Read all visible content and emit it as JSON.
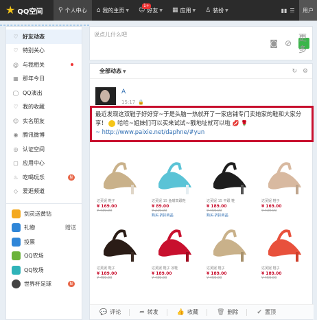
{
  "topbar": {
    "logo_text": "QQ空间",
    "nav": [
      {
        "label": "个人中心",
        "icon": "person-icon"
      },
      {
        "label": "我的主页",
        "icon": "home-icon",
        "caret": "▼"
      },
      {
        "label": "好友",
        "icon": "friends-icon",
        "caret": "▼",
        "badge": "1+"
      },
      {
        "label": "应用",
        "icon": "apps-icon",
        "caret": "▼"
      },
      {
        "label": "装扮",
        "icon": "shirt-icon",
        "caret": "▼"
      }
    ],
    "user_center": "用户"
  },
  "sidebar": {
    "items": [
      {
        "label": "好友动态",
        "icon": "♡"
      },
      {
        "label": "特别关心",
        "icon": "♡"
      },
      {
        "label": "与我相关",
        "icon": "@"
      },
      {
        "label": "那年今日",
        "icon": "▦"
      },
      {
        "label": "QQ演出",
        "icon": "◯"
      },
      {
        "label": "我的收藏",
        "icon": "♡"
      },
      {
        "label": "实名朋友",
        "icon": "☺"
      },
      {
        "label": "腾讯微博",
        "icon": "◉"
      },
      {
        "label": "认证空间",
        "icon": "◎"
      },
      {
        "label": "应用中心",
        "icon": "▢"
      },
      {
        "label": "吃喝玩乐",
        "icon": "♨",
        "badge": "N"
      },
      {
        "label": "爱逛频道",
        "icon": "◇"
      }
    ],
    "apps": [
      {
        "label": "剑灵送黄钻",
        "color": "#f4a91e"
      },
      {
        "label": "礼物",
        "color": "#2f86d8",
        "extra": "赠送"
      },
      {
        "label": "投票",
        "color": "#2f86d8"
      },
      {
        "label": "QQ农场",
        "color": "#6bb33a"
      },
      {
        "label": "QQ牧场",
        "color": "#2fb3b8"
      },
      {
        "label": "世界杯足球",
        "color": "#444",
        "badge": "N"
      }
    ]
  },
  "composer": {
    "placeholder": "说点儿什么吧",
    "tools": [
      "camera-icon",
      "attachment-icon",
      "more-icon"
    ],
    "tool_chars": [
      "◙",
      "⊘"
    ],
    "more_label": "更多"
  },
  "feed": {
    "filter_label": "全部动态",
    "filter_caret": "▼",
    "refresh_icon": "↻",
    "settings_icon": "⚙"
  },
  "post": {
    "author": "A",
    "time": "15:17",
    "lock_icon": "🔒",
    "text_part1": "最近发现这双鞋子好好穿~于是头脑一热就开了一家店铺专门卖她家的鞋和大家分享！",
    "text_part2": "哈哈~姐妹们可以买来试试~戳地址就可以啦",
    "lips": "💋",
    "rose": "🌹",
    "link": "~ http://www.paixie.net/daphne/#yun"
  },
  "products": [
    {
      "name": "达芙妮 鞋子",
      "price": "¥ 169.00",
      "orig": "¥ 439.00",
      "tag": "",
      "color": "#c9b18a",
      "heel": "#e0d6c8"
    },
    {
      "name": "达芙妮 15 鱼嘴高跟鞋",
      "price": "¥ 89.00",
      "orig": "¥ 219.00",
      "tag": "购买·折扣商品",
      "color": "#5ac3d6",
      "heel": "#e6eef2"
    },
    {
      "name": "达芙妮 15 平跟 鞋",
      "price": "¥ 189.00",
      "orig": "¥ 459.00",
      "tag": "购买·折扣商品",
      "color": "#1e1e1e",
      "heel": "#555"
    },
    {
      "name": "达芙妮 鞋子",
      "price": "¥ 169.00",
      "orig": "¥ 439.00",
      "tag": "",
      "color": "#d8b9a0",
      "heel": "#bfa58d"
    },
    {
      "name": "达芙妮 鞋子",
      "price": "¥ 189.00",
      "orig": "¥ 459.00",
      "tag": "",
      "color": "#2a1c16",
      "heel": "#3a2a22"
    },
    {
      "name": "达芙妮 鞋子 凉鞋",
      "price": "¥ 189.00",
      "orig": "¥ 439.00",
      "tag": "",
      "color": "#c8102e",
      "heel": "#a00c22"
    },
    {
      "name": "达芙妮 鞋子",
      "price": "¥ 189.00",
      "orig": "¥ 459.00",
      "tag": "",
      "color": "#c9b18a",
      "heel": "#a8926e"
    },
    {
      "name": "达芙妮 鞋子",
      "price": "¥ 189.00",
      "orig": "¥ 459.00",
      "tag": "",
      "color": "#e8513c",
      "heel": "#cf3f2c"
    }
  ],
  "actions": [
    {
      "label": "评论",
      "icon": "comment-icon",
      "glyph": "💬"
    },
    {
      "label": "转发",
      "icon": "share-icon",
      "glyph": "➦"
    },
    {
      "label": "收藏",
      "icon": "like-icon",
      "glyph": "👍"
    },
    {
      "label": "删除",
      "icon": "trash-icon",
      "glyph": "🗑"
    },
    {
      "label": "置顶",
      "icon": "pin-icon",
      "glyph": "✔"
    }
  ]
}
